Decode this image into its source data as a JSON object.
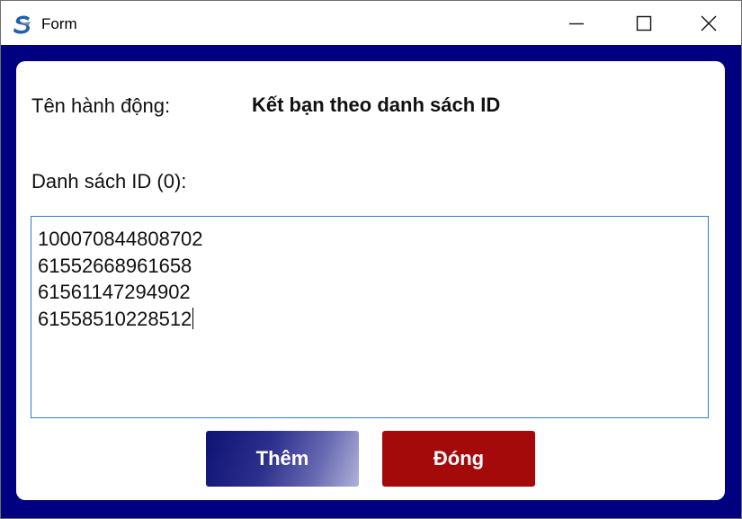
{
  "window": {
    "title": "Form",
    "icon": "app-logo-icon",
    "controls": {
      "minimize": "minimize-icon",
      "maximize": "maximize-icon",
      "close": "close-icon"
    }
  },
  "form": {
    "action_label": "Tên hành động:",
    "action_value": "Kết bạn theo danh sách ID",
    "list_label": "Danh sách ID (0):",
    "ids": [
      "100070844808702",
      "61552668961658",
      "61561147294902",
      "61558510228512"
    ],
    "add_button": "Thêm",
    "close_button": "Đóng"
  },
  "colors": {
    "frame": "#000080",
    "add_button": "#0e1274",
    "close_button": "#a40a0a",
    "input_border": "#2b7bd6"
  }
}
